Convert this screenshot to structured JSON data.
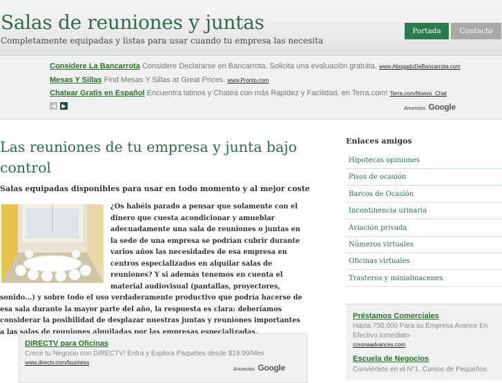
{
  "header": {
    "title": "Salas de reuniones y juntas",
    "subtitle": "Completamente equipadas y listas para usar cuando tu empresa las necesita",
    "nav": {
      "portada": "Portada",
      "contacto": "Contacto"
    }
  },
  "top_ads": {
    "items": [
      {
        "title": "Considere La Bancarrota",
        "text": "Considere Declararse en Bancarrota. Solicita una evaluación gratuita.",
        "url": "www.AbogadoDeBancarrota.com"
      },
      {
        "title": "Mesas Y Sillas",
        "text": "Find Mesas Y Sillas at Great Prices.",
        "url": "www.Pronto.com"
      },
      {
        "title": "Chatear Gratis en Español",
        "text": "Encuentra latinos y Chatea con más Rapidez y Facilidad, en Terra.com!",
        "url": "Terra.com/Nuevo_Chat"
      }
    ],
    "ads_by": "Anuncios",
    "brand": "Google"
  },
  "main": {
    "title": "Las reuniones de tu empresa y junta bajo control",
    "subtitle": "Salas equipadas disponibles para usar en todo momento y al mejor coste",
    "paragraph": "¿Os habéis parado a pensar que solamente con el dinero que cuesta acondicionar y amueblar adecuadamente una sala de reuniones o juntas en la sede de una empresa se podrían cubrir durante varios años las necesidades de esa empresa en centros especializados en alquilar salas de reuniones? Y si además tenemos en cuenta el material audiovisual (pantallas, proyectores, sonido...) y sobre todo el uso verdaderamente productivo que podría hacerse de esa sala durante la mayor parte del año, la respuesta es clara: deberíamos considerar la posibilidad de desplazar nuestras juntas y reuniones importantes a las salas de reuniones alquiladas por las empresas especializadas."
  },
  "bottom_ad": {
    "title": "DIRECTV para Oficinas",
    "text": "Crece tu Negocio con DIRECTV! Entra y Explora Paquetes desde $19.99/Mes",
    "url": "www.directv.com/business",
    "ads_by": "Anuncios",
    "brand": "Google"
  },
  "sidebar": {
    "heading": "Enlaces amigos",
    "links": [
      "Hipotecas opiniones",
      "Pisos de ocasión",
      "Barcos de Ocasión",
      "Incontinencia urinaria",
      "Aviación privada",
      "Números virtuales",
      "Oficinas virtuales",
      "Trasteros y minialmacenes"
    ],
    "ads": [
      {
        "title": "Préstamos Comerciales",
        "text": "Hasta 750,000 Para su Empresa Avance En Efectivo Inmediato",
        "url": "coronaadvances.com"
      },
      {
        "title": "Escuela de Negocios",
        "text": "Conviértete en el N°1. Cursos de Pequeños"
      }
    ]
  },
  "colors": {
    "title_green": "#2f6b4a",
    "nav_active": "#2c7a4d",
    "nav_inactive": "#a8a8a8",
    "ad_link": "#2c6f2c"
  }
}
